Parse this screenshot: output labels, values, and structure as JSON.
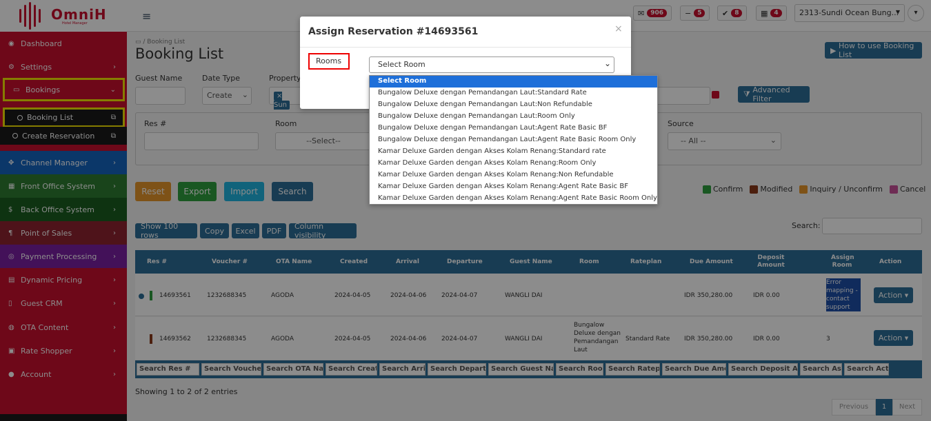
{
  "brand": {
    "name": "OmniH",
    "tagline": "Hotel Manager"
  },
  "topbar": {
    "messages_count": "906",
    "minus_count": "5",
    "check_count": "8",
    "calendar_count": "4",
    "property": "2313-Sundi Ocean Bung..."
  },
  "sidebar": {
    "items": [
      {
        "label": "Dashboard",
        "icon": "dashboard-icon"
      },
      {
        "label": "Settings",
        "icon": "gear-icon"
      },
      {
        "label": "Bookings",
        "icon": "bookings-icon"
      },
      {
        "label": "Channel Manager",
        "icon": "move-icon"
      },
      {
        "label": "Front Office System",
        "icon": "calendar-icon"
      },
      {
        "label": "Back Office System",
        "icon": "dollar-icon"
      },
      {
        "label": "Point of Sales",
        "icon": "utensils-icon"
      },
      {
        "label": "Payment Processing",
        "icon": "target-icon"
      },
      {
        "label": "Dynamic Pricing",
        "icon": "chart-icon"
      },
      {
        "label": "Guest CRM",
        "icon": "document-icon"
      },
      {
        "label": "OTA Content",
        "icon": "globe-icon"
      },
      {
        "label": "Rate Shopper",
        "icon": "cart-icon"
      },
      {
        "label": "Account",
        "icon": "user-icon"
      }
    ],
    "subitems": [
      {
        "label": "Booking List"
      },
      {
        "label": "Create Reservation"
      }
    ],
    "colors": [
      "#c8102e",
      "#c8102e",
      "#1a1a1a",
      "#1565c0",
      "#2e7d32",
      "#1b5e20",
      "#8e2430",
      "#7b1fa2",
      "#c8102e",
      "#c8102e",
      "#c8102e",
      "#c8102e",
      "#c8102e"
    ]
  },
  "page": {
    "breadcrumb": "Booking List",
    "title": "Booking List",
    "how_to_button": "How to use Booking List",
    "advanced_filter": "Advanced Filter"
  },
  "filters": {
    "guest_name_label": "Guest Name",
    "date_type_label": "Date Type",
    "date_type_value": "Create",
    "property_label": "Property",
    "property_chip": "Sun",
    "res_label": "Res #",
    "room_label": "Room",
    "room_value": "--Select--",
    "source_label": "Source",
    "source_value": "-- All --"
  },
  "actions": {
    "reset": "Reset",
    "export": "Export",
    "import": "Import",
    "search": "Search"
  },
  "legend": [
    {
      "label": "Confirm",
      "color": "#2e9e3e"
    },
    {
      "label": "Modified",
      "color": "#8b3a1a"
    },
    {
      "label": "Inquiry / Unconfirm",
      "color": "#e6952a"
    },
    {
      "label": "Cancel",
      "color": "#c9509a"
    }
  ],
  "table_tools": {
    "show_rows": "Show 100 rows",
    "copy": "Copy",
    "excel": "Excel",
    "pdf": "PDF",
    "column_visibility": "Column visibility",
    "search_label": "Search:"
  },
  "table": {
    "headers": [
      "Res #",
      "Voucher #",
      "OTA Name",
      "Created",
      "Arrival",
      "Departure",
      "Guest Name",
      "Room",
      "Rateplan",
      "Due Amount",
      "Deposit Amount",
      "Assign Room",
      "Action"
    ],
    "rows": [
      {
        "res": "14693561",
        "voucher": "1232688345",
        "ota": "AGODA",
        "created": "2024-04-05",
        "arrival": "2024-04-06",
        "departure": "2024-04-07",
        "guest": "WANGLI DAI",
        "room": "",
        "rateplan": "",
        "due": "IDR 350,280.00",
        "deposit": "IDR 0.00",
        "assign": "Error mapping - contact support",
        "action": "Action",
        "status_color": "#2e9e3e"
      },
      {
        "res": "14693562",
        "voucher": "1232688345",
        "ota": "AGODA",
        "created": "2024-04-05",
        "arrival": "2024-04-06",
        "departure": "2024-04-07",
        "guest": "WANGLI DAI",
        "room": "Bungalow Deluxe dengan Pemandangan Laut",
        "rateplan": "Standard Rate",
        "due": "IDR 350,280.00",
        "deposit": "IDR 0.00",
        "assign": "3",
        "action": "Action",
        "status_color": "#8b3a1a"
      }
    ],
    "footer_search": [
      "Search Res #",
      "Search Voucher",
      "Search OTA Nar",
      "Search Creat",
      "Search Arriv",
      "Search Departu",
      "Search Guest Nar",
      "Search Roor",
      "Search Ratepl",
      "Search Due Amo",
      "Search Deposit An",
      "Search Ass",
      "Search Actic"
    ],
    "info": "Showing 1 to 2 of 2 entries",
    "pagination": {
      "previous": "Previous",
      "page": "1",
      "next": "Next"
    }
  },
  "modal": {
    "title": "Assign Reservation #14693561",
    "close": "×",
    "rooms_label": "Rooms",
    "select_value": "Select Room",
    "options": [
      "Select Room",
      "Bungalow Deluxe dengan Pemandangan Laut:Standard Rate",
      "Bungalow Deluxe dengan Pemandangan Laut:Non Refundable",
      "Bungalow Deluxe dengan Pemandangan Laut:Room Only",
      "Bungalow Deluxe dengan Pemandangan Laut:Agent Rate Basic BF",
      "Bungalow Deluxe dengan Pemandangan Laut:Agent Rate Basic Room Only",
      "Kamar Deluxe Garden dengan Akses Kolam Renang:Standard rate",
      "Kamar Deluxe Garden dengan Akses Kolam Renang:Room Only",
      "Kamar Deluxe Garden dengan Akses Kolam Renang:Non Refundable",
      "Kamar Deluxe Garden dengan Akses Kolam Renang:Agent Rate Basic BF",
      "Kamar Deluxe Garden dengan Akses Kolam Renang:Agent Rate Basic Room Only"
    ]
  }
}
